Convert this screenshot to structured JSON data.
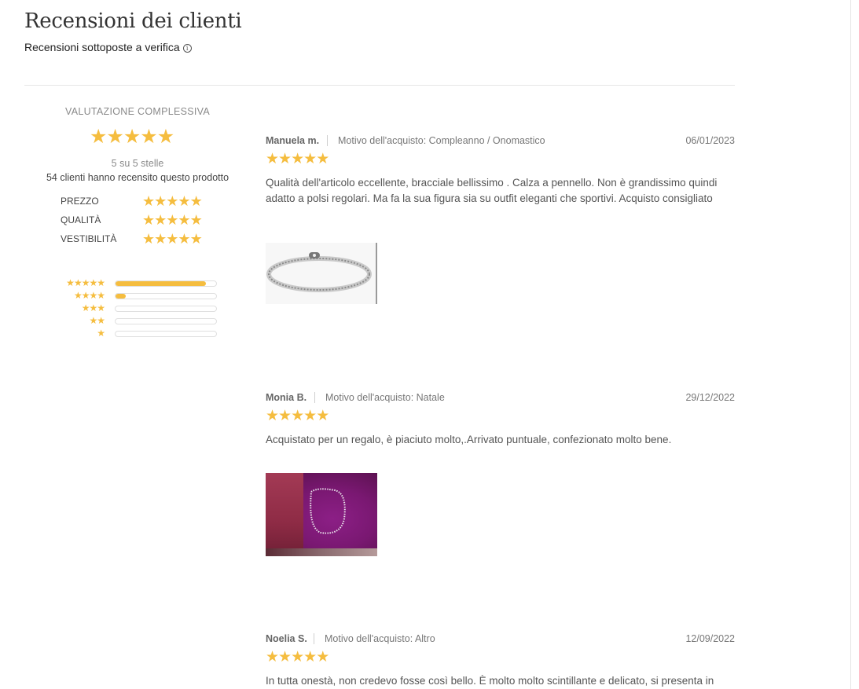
{
  "header": {
    "title": "Recensioni dei clienti",
    "subtitle": "Recensioni sottoposte a verifica",
    "info_glyph": "i"
  },
  "summary": {
    "heading": "VALUTAZIONE COMPLESSIVA",
    "rating": 5,
    "score_text": "5 su 5 stelle",
    "count_text": "54 clienti hanno recensito questo prodotto",
    "attributes": [
      {
        "label": "PREZZO",
        "rating": 5
      },
      {
        "label": "QUALITÀ",
        "rating": 5
      },
      {
        "label": "VESTIBILITÀ",
        "rating": 5
      }
    ],
    "distribution": [
      {
        "stars": 5,
        "fraction": 0.9
      },
      {
        "stars": 4,
        "fraction": 0.1
      },
      {
        "stars": 3,
        "fraction": 0
      },
      {
        "stars": 2,
        "fraction": 0
      },
      {
        "stars": 1,
        "fraction": 0
      }
    ]
  },
  "reviews": [
    {
      "author": "Manuela m.",
      "reason": "Motivo dell'acquisto: Compleanno / Onomastico",
      "date": "06/01/2023",
      "rating": 5,
      "text": "Qualità dell'articolo eccellente, bracciale bellissimo . Calza a pennello. Non è grandissimo quindi adatto a polsi regolari. Ma fa la sua figura sia su outfit eleganti che sportivi. Acquisto consigliato",
      "photo": "bracelet-photo"
    },
    {
      "author": "Monia B.",
      "reason": "Motivo dell'acquisto: Natale",
      "date": "29/12/2022",
      "rating": 5,
      "text": "Acquistato per un regalo, è piaciuto molto,.Arrivato puntuale, confezionato molto bene.",
      "photo": "gift-box-photo"
    },
    {
      "author": "Noelia S.",
      "reason": "Motivo dell'acquisto: Altro",
      "date": "12/09/2022",
      "rating": 5,
      "text": "In tutta onestà, non credevo fosse così bello. È molto molto scintillante e delicato, si presenta in",
      "photo": ""
    }
  ],
  "colors": {
    "star": "#f5bd3f",
    "bar_track_border": "#e0e0e0"
  },
  "icons": {
    "star": "★",
    "info": "info-icon"
  }
}
